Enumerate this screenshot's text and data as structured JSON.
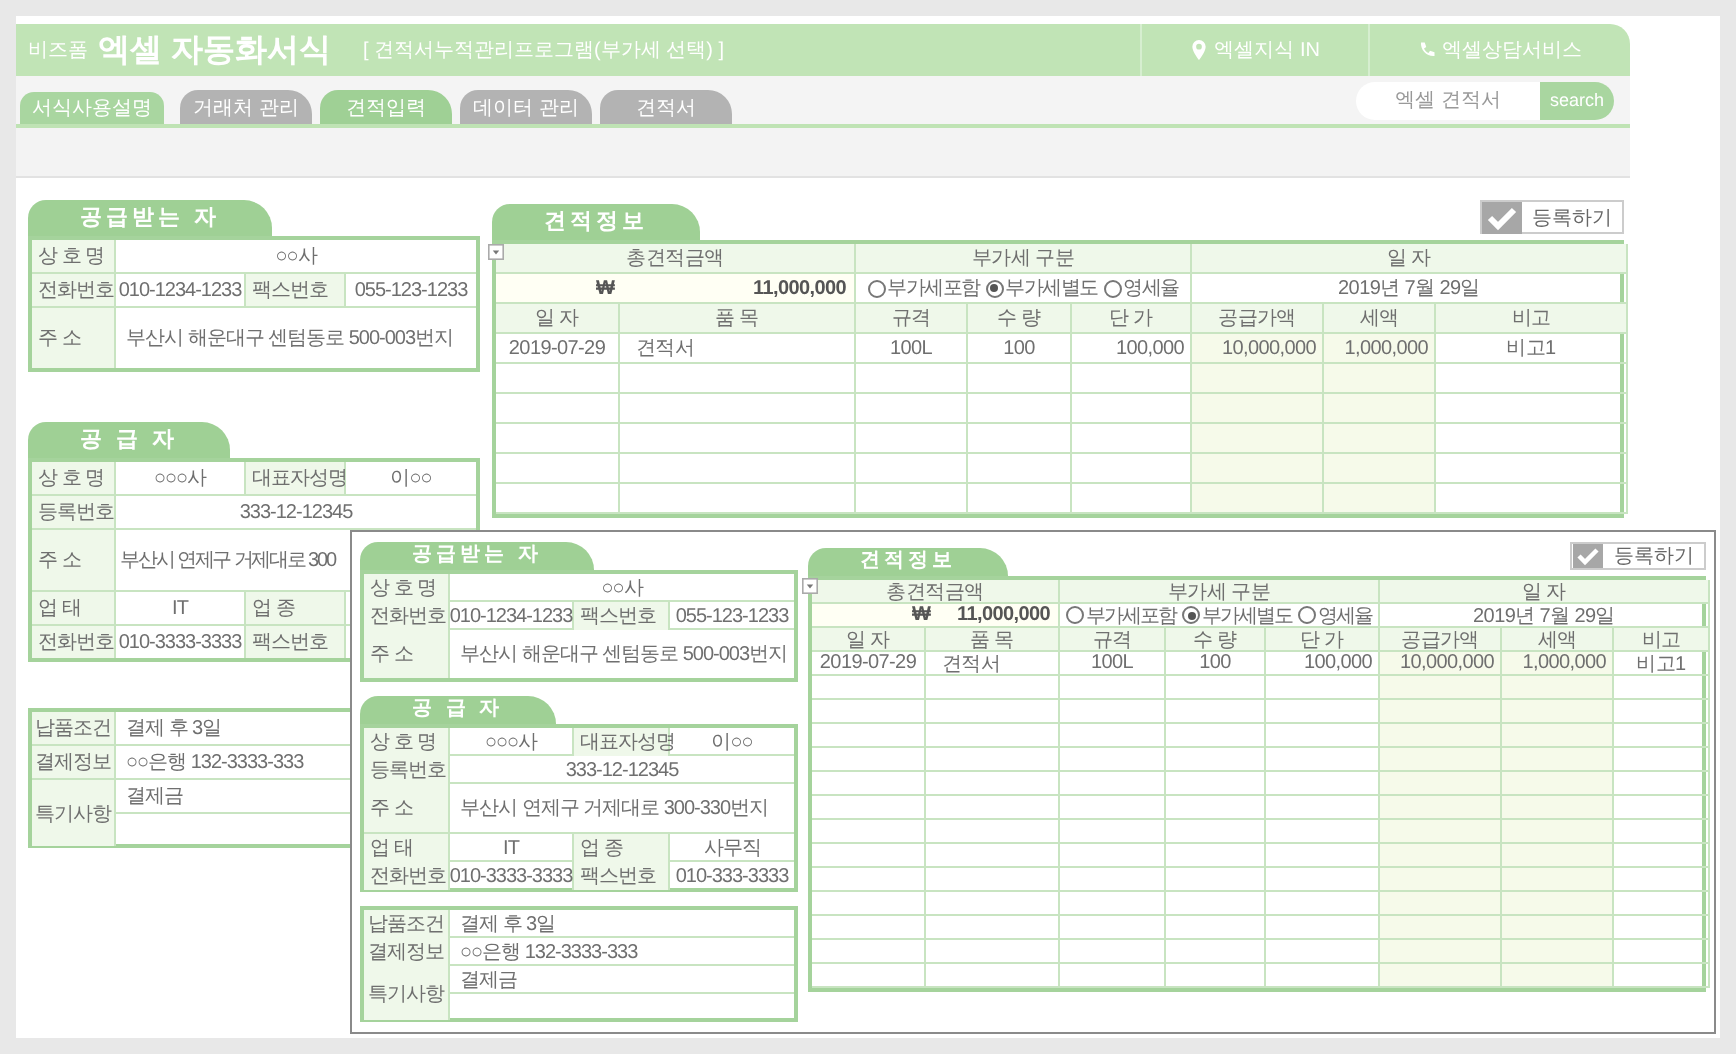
{
  "header": {
    "brand": "비즈폼",
    "title": "엑셀 자동화서식",
    "subtitle": "[ 견적서누적관리프로그램(부가세 선택) ]",
    "links": [
      "엑셀지식 IN",
      "엑셀상담서비스"
    ]
  },
  "guide_button": "서식사용설명",
  "tabs": [
    {
      "label": "거래처 관리",
      "selected": false
    },
    {
      "label": "견적입력",
      "selected": true
    },
    {
      "label": "데이터 관리",
      "selected": false
    },
    {
      "label": "견적서",
      "selected": false
    }
  ],
  "search": {
    "placeholder": "엑셀 견적서",
    "button": "search"
  },
  "main": {
    "receiver": {
      "title": "공급받는 자",
      "rows": [
        {
          "kind": "single",
          "cells": [
            "상 호 명",
            "○○사"
          ]
        },
        {
          "kind": "quad",
          "cells": [
            "전화번호",
            "010-1234-1233",
            "팩스번호",
            "055-123-1233"
          ]
        },
        {
          "kind": "tall",
          "cells": [
            "주 소",
            "부산시 해운대구 센텀동로 500-003번지"
          ]
        }
      ]
    },
    "supplier": {
      "title": "공 급 자",
      "rows": [
        {
          "kind": "quad",
          "cells": [
            "상 호 명",
            "○○○사",
            "대표자성명",
            "이○○"
          ]
        },
        {
          "kind": "single",
          "cells": [
            "등록번호",
            "333-12-12345"
          ]
        },
        {
          "kind": "tall",
          "cells": [
            "주 소",
            "부산시 연제구 거제대로 300"
          ]
        },
        {
          "kind": "quad",
          "cells": [
            "업 태",
            "IT",
            "업 종"
          ]
        },
        {
          "kind": "quad",
          "cells": [
            "전화번호",
            "010-3333-3333",
            "팩스번호"
          ]
        }
      ]
    },
    "payment": {
      "rows": [
        {
          "kind": "single",
          "cells": [
            "납품조건",
            "결제 후 3일"
          ]
        },
        {
          "kind": "single",
          "cells": [
            "결제정보",
            "○○은행 132-3333-333"
          ]
        },
        {
          "kind": "note",
          "cells": [
            "특기사항",
            "결제금"
          ]
        }
      ]
    },
    "estimate": {
      "title": "견적정보",
      "register_button": "등록하기",
      "total_label": "총견적금액",
      "vat_label": "부가세 구분",
      "date_label": "일 자",
      "currency": "₩",
      "total": "11,000,000",
      "vat_options": [
        {
          "label": "부가세포함",
          "selected": false
        },
        {
          "label": "부가세별도",
          "selected": true
        },
        {
          "label": "영세율",
          "selected": false
        }
      ],
      "date": "2019년 7월 29일",
      "columns": [
        "일 자",
        "품 목",
        "규격",
        "수 량",
        "단 가",
        "공급가액",
        "세액",
        "비고"
      ],
      "rows": [
        [
          "2019-07-29",
          "견적서",
          "100L",
          "100",
          "100,000",
          "10,000,000",
          "1,000,000",
          "비고1"
        ]
      ]
    }
  },
  "inset": {
    "receiver": {
      "title": "공급받는 자",
      "rows": [
        {
          "kind": "single",
          "cells": [
            "상 호 명",
            "○○사"
          ]
        },
        {
          "kind": "quad",
          "cells": [
            "전화번호",
            "010-1234-1233",
            "팩스번호",
            "055-123-1233"
          ]
        },
        {
          "kind": "tall",
          "cells": [
            "주 소",
            "부산시 해운대구 센텀동로 500-003번지"
          ]
        }
      ]
    },
    "supplier": {
      "title": "공 급 자",
      "rows": [
        {
          "kind": "quad",
          "cells": [
            "상 호 명",
            "○○○사",
            "대표자성명",
            "이○○"
          ]
        },
        {
          "kind": "single",
          "cells": [
            "등록번호",
            "333-12-12345"
          ]
        },
        {
          "kind": "tall",
          "cells": [
            "주 소",
            "부산시 연제구 거제대로 300-330번지"
          ]
        },
        {
          "kind": "quad",
          "cells": [
            "업 태",
            "IT",
            "업 종",
            "사무직"
          ]
        },
        {
          "kind": "quad",
          "cells": [
            "전화번호",
            "010-3333-3333",
            "팩스번호",
            "010-333-3333"
          ]
        }
      ]
    },
    "payment": {
      "rows": [
        {
          "kind": "single",
          "cells": [
            "납품조건",
            "결제 후 3일"
          ]
        },
        {
          "kind": "single",
          "cells": [
            "결제정보",
            "○○은행 132-3333-333"
          ]
        },
        {
          "kind": "note",
          "cells": [
            "특기사항",
            "결제금"
          ]
        }
      ]
    },
    "estimate": {
      "title": "견적정보",
      "register_button": "등록하기",
      "total_label": "총견적금액",
      "vat_label": "부가세 구분",
      "date_label": "일 자",
      "currency": "₩",
      "total": "11,000,000",
      "vat_options": [
        {
          "label": "부가세포함",
          "selected": false
        },
        {
          "label": "부가세별도",
          "selected": true
        },
        {
          "label": "영세율",
          "selected": false
        }
      ],
      "date": "2019년 7월 29일",
      "columns": [
        "일 자",
        "품 목",
        "규격",
        "수 량",
        "단 가",
        "공급가액",
        "세액",
        "비고"
      ],
      "rows": [
        [
          "2019-07-29",
          "견적서",
          "100L",
          "100",
          "100,000",
          "10,000,000",
          "1,000,000",
          "비고1"
        ]
      ]
    }
  }
}
